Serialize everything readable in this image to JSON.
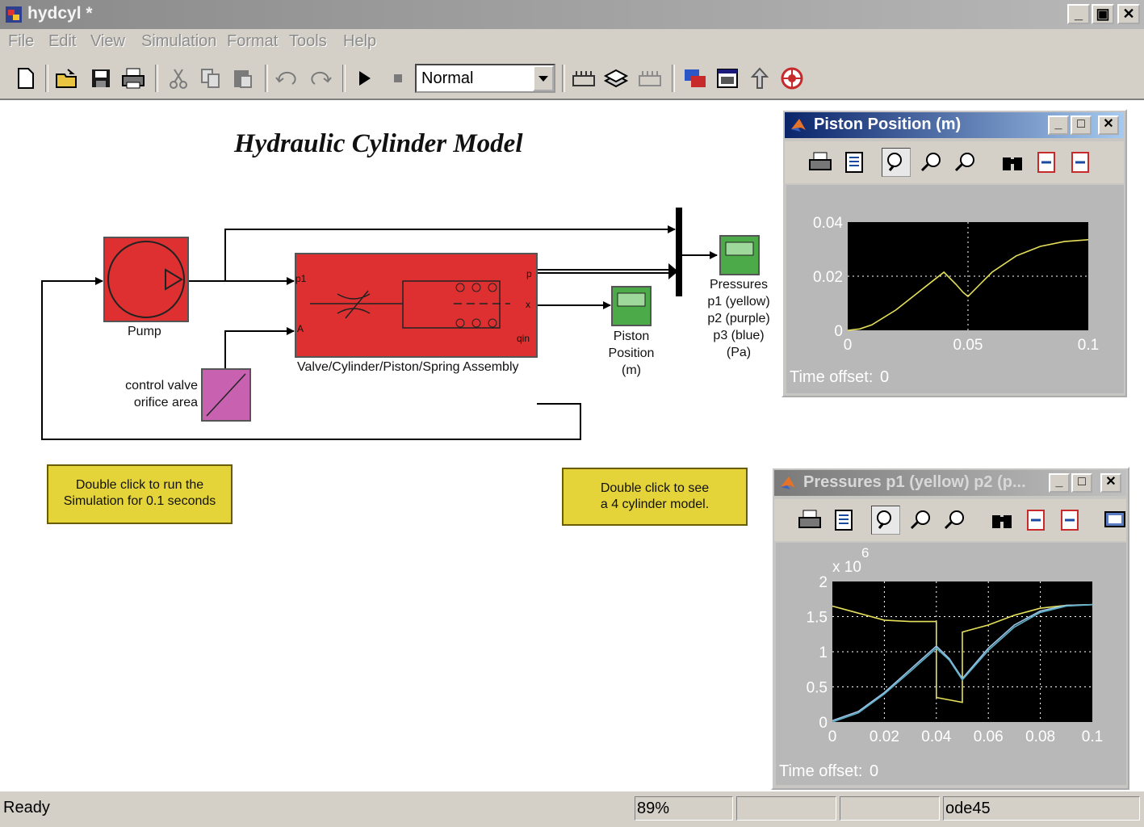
{
  "window": {
    "title": "hydcyl *",
    "min": "_",
    "max": "▣",
    "close": "✕"
  },
  "menu": [
    "File",
    "Edit",
    "View",
    "Simulation",
    "Format",
    "Tools",
    "Help"
  ],
  "toolbar": {
    "sim_mode": "Normal"
  },
  "model": {
    "title": "Hydraulic Cylinder Model",
    "pump_label": "Pump",
    "assembly_label": "Valve/Cylinder/Piston/Spring Assembly",
    "port_p1": "p1",
    "port_A": "A",
    "port_p": "p",
    "port_x": "x",
    "port_qin": "qin",
    "control_label_1": "control valve",
    "control_label_2": "orifice area",
    "piston_scope_label": [
      "Piston",
      "Position",
      "(m)"
    ],
    "pressures_scope_label": [
      "Pressures",
      "p1 (yellow)",
      "p2 (purple)",
      "p3 (blue)",
      "(Pa)"
    ],
    "note_run": [
      "Double click to run the",
      "Simulation for 0.1 seconds"
    ],
    "note_cyl": [
      "Double click to see",
      "a 4 cylinder model."
    ]
  },
  "scope1": {
    "title": "Piston Position (m)",
    "time_offset_label": "Time offset:",
    "time_offset_value": "0"
  },
  "scope2": {
    "title": "Pressures p1 (yellow) p2 (p...",
    "time_offset_label": "Time offset:",
    "time_offset_value": "0",
    "exponent": "x 10",
    "exponent_power": "6"
  },
  "status": {
    "state": "Ready",
    "zoom": "89%",
    "solver": "ode45"
  },
  "chart_data": [
    {
      "type": "line",
      "title": "Piston Position (m)",
      "xlim": [
        0,
        0.1
      ],
      "ylim": [
        0,
        0.04
      ],
      "xticks": [
        "0",
        "0.05",
        "0.1"
      ],
      "yticks": [
        "0",
        "0.02",
        "0.04"
      ],
      "grid": true,
      "series": [
        {
          "color": "#e6e05a",
          "x": [
            0,
            0.005,
            0.01,
            0.02,
            0.03,
            0.04,
            0.045,
            0.048,
            0.05,
            0.055,
            0.06,
            0.07,
            0.08,
            0.09,
            0.1
          ],
          "y": [
            0,
            0.0005,
            0.002,
            0.0075,
            0.0145,
            0.0215,
            0.017,
            0.014,
            0.0125,
            0.017,
            0.0215,
            0.0275,
            0.031,
            0.0328,
            0.0335
          ]
        }
      ]
    },
    {
      "type": "line",
      "title": "Pressures p1 (yellow) p2 (p...",
      "xlim": [
        0,
        0.1
      ],
      "ylim": [
        0,
        2
      ],
      "y_multiplier": "x 10^6",
      "xticks": [
        "0",
        "0.02",
        "0.04",
        "0.06",
        "0.08",
        "0.1"
      ],
      "yticks": [
        "0",
        "0.5",
        "1",
        "1.5",
        "2"
      ],
      "grid": true,
      "series": [
        {
          "color": "#e6e05a",
          "x": [
            0,
            0.005,
            0.01,
            0.02,
            0.03,
            0.04,
            0.04,
            0.05,
            0.05,
            0.06,
            0.07,
            0.08,
            0.09,
            0.1
          ],
          "y": [
            1.65,
            1.6,
            1.55,
            1.45,
            1.43,
            1.43,
            0.35,
            0.28,
            1.28,
            1.38,
            1.52,
            1.62,
            1.66,
            1.67
          ]
        },
        {
          "color": "#9ec4e8",
          "x": [
            0,
            0.01,
            0.02,
            0.03,
            0.04,
            0.045,
            0.05,
            0.06,
            0.07,
            0.08,
            0.09,
            0.1
          ],
          "y": [
            0.02,
            0.15,
            0.42,
            0.75,
            1.08,
            0.9,
            0.62,
            1.05,
            1.38,
            1.58,
            1.66,
            1.67
          ]
        },
        {
          "color": "#5fb0c8",
          "x": [
            0,
            0.01,
            0.02,
            0.03,
            0.04,
            0.045,
            0.05,
            0.06,
            0.07,
            0.08,
            0.09,
            0.1
          ],
          "y": [
            0,
            0.13,
            0.4,
            0.72,
            1.05,
            0.88,
            0.6,
            1.02,
            1.35,
            1.56,
            1.65,
            1.67
          ]
        }
      ]
    }
  ]
}
